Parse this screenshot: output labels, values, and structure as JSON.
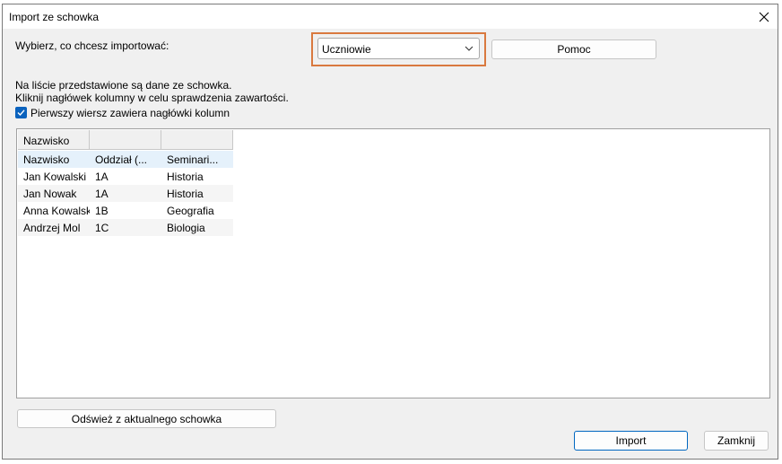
{
  "window": {
    "title": "Import ze schowka"
  },
  "prompt": {
    "label": "Wybierz, co chcesz importować:",
    "selected": "Uczniowie",
    "help_label": "Pomoc"
  },
  "info": {
    "line1": "Na liście przedstawione są dane ze schowka.",
    "line2": "Kliknij nagłówek kolumny w celu sprawdzenia zawartości."
  },
  "checkbox": {
    "label": "Pierwszy wiersz zawiera nagłówki kolumn",
    "checked": true
  },
  "grid": {
    "columns": [
      "Nazwisko",
      "",
      ""
    ],
    "rows": [
      [
        "Nazwisko",
        "Oddział (...",
        "Seminari..."
      ],
      [
        "Jan Kowalski",
        "1A",
        "Historia"
      ],
      [
        "Jan Nowak",
        "1A",
        "Historia"
      ],
      [
        "Anna Kowalska",
        "1B",
        "Geografia"
      ],
      [
        "Andrzej Mol",
        "1C",
        "Biologia"
      ]
    ]
  },
  "buttons": {
    "refresh": "Odśwież z aktualnego schowka",
    "import": "Import",
    "close": "Zamknij"
  },
  "colors": {
    "highlight": "#d9793f",
    "checkbox": "#0a62bd",
    "selected_row": "#e5f1fb"
  }
}
